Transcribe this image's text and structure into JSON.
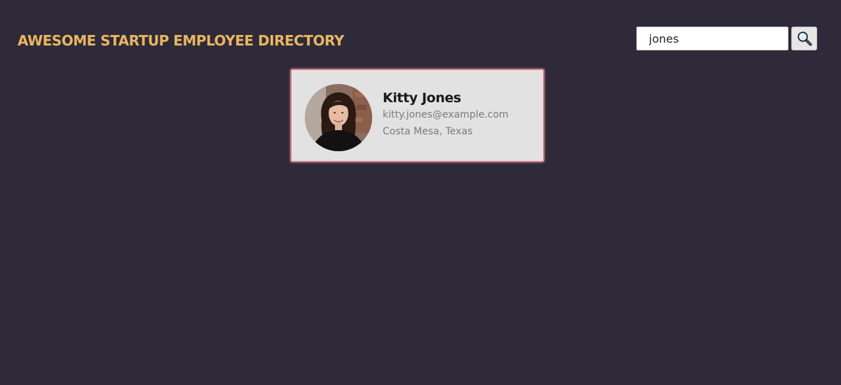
{
  "header": {
    "title": "AWESOME STARTUP EMPLOYEE DIRECTORY"
  },
  "search": {
    "value": "jones",
    "button_icon": "magnifying-glass-icon"
  },
  "employees": [
    {
      "name": "Kitty Jones",
      "email": "kitty.jones@example.com",
      "location": "Costa Mesa, Texas",
      "avatar": "portrait-photo"
    }
  ],
  "colors": {
    "background": "#2e2a39",
    "title": "#e9b561",
    "card_background": "#e3e2e2",
    "card_border": "#c97a84"
  }
}
